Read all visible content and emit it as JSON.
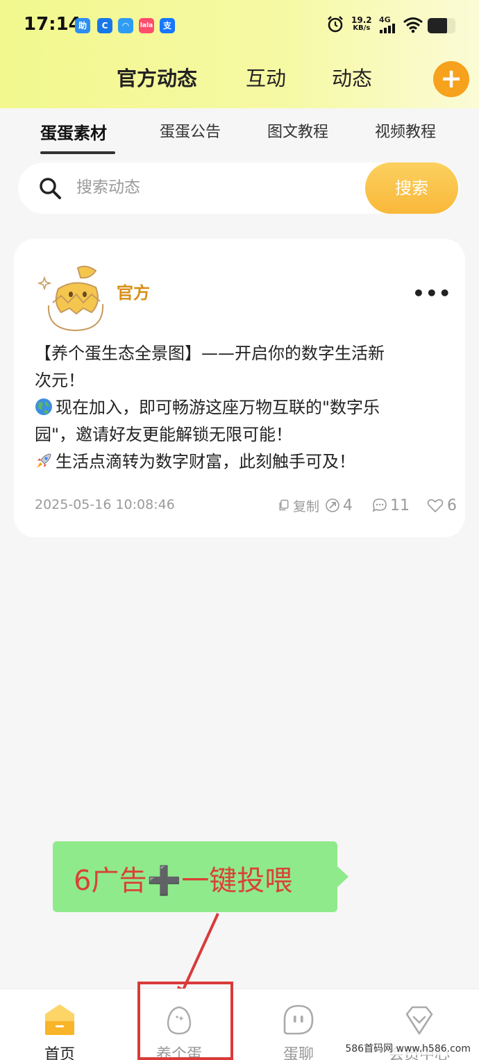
{
  "status_bar": {
    "time": "17:14",
    "speed_value": "19.2",
    "speed_unit": "KB/s",
    "network": "4G",
    "app_icons": [
      {
        "name": "app-icon-1",
        "color": "#2b8ef0",
        "glyph": "助"
      },
      {
        "name": "app-icon-2",
        "color": "#1877e6",
        "glyph": "C"
      },
      {
        "name": "app-icon-3",
        "color": "#2e9cf2",
        "glyph": "◠"
      },
      {
        "name": "app-icon-4",
        "color": "#ff4d6d",
        "glyph": "lala"
      },
      {
        "name": "app-icon-5",
        "color": "#1677ff",
        "glyph": "支"
      }
    ]
  },
  "header": {
    "tabs": [
      {
        "label": "官方动态",
        "active": true
      },
      {
        "label": "互动",
        "active": false
      },
      {
        "label": "动态",
        "active": false
      }
    ],
    "add_label": "+"
  },
  "sub_tabs": [
    {
      "label": "蛋蛋素材",
      "active": true
    },
    {
      "label": "蛋蛋公告",
      "active": false
    },
    {
      "label": "图文教程",
      "active": false
    },
    {
      "label": "视频教程",
      "active": false
    }
  ],
  "search": {
    "placeholder": "搜索动态",
    "button_label": "搜索"
  },
  "post": {
    "author": "官方",
    "more": "•••",
    "lines": [
      "【养个蛋生态全景图】——开启你的数字生活新",
      "次元！",
      "现在加入，即可畅游这座万物互联的\"数字乐",
      "园\"，邀请好友更能解锁无限可能！",
      "生活点滴转为数字财富，此刻触手可及！"
    ],
    "time": "2025-05-16 10:08:46",
    "copy_label": "复制",
    "share_count": "4",
    "comment_count": "11",
    "like_count": "6"
  },
  "annotation": {
    "text": "6广告➕一键投喂",
    "color": "#d94236"
  },
  "bottom_nav": [
    {
      "label": "首页",
      "active": true
    },
    {
      "label": "养个蛋",
      "active": false
    },
    {
      "label": "蛋聊",
      "active": false
    },
    {
      "label": "会员中心",
      "active": false
    }
  ],
  "watermark": "586首码网 www.h586.com",
  "colors": {
    "accent": "#f6a21c",
    "author": "#d88e16",
    "callout_bg": "#8fea8b"
  }
}
